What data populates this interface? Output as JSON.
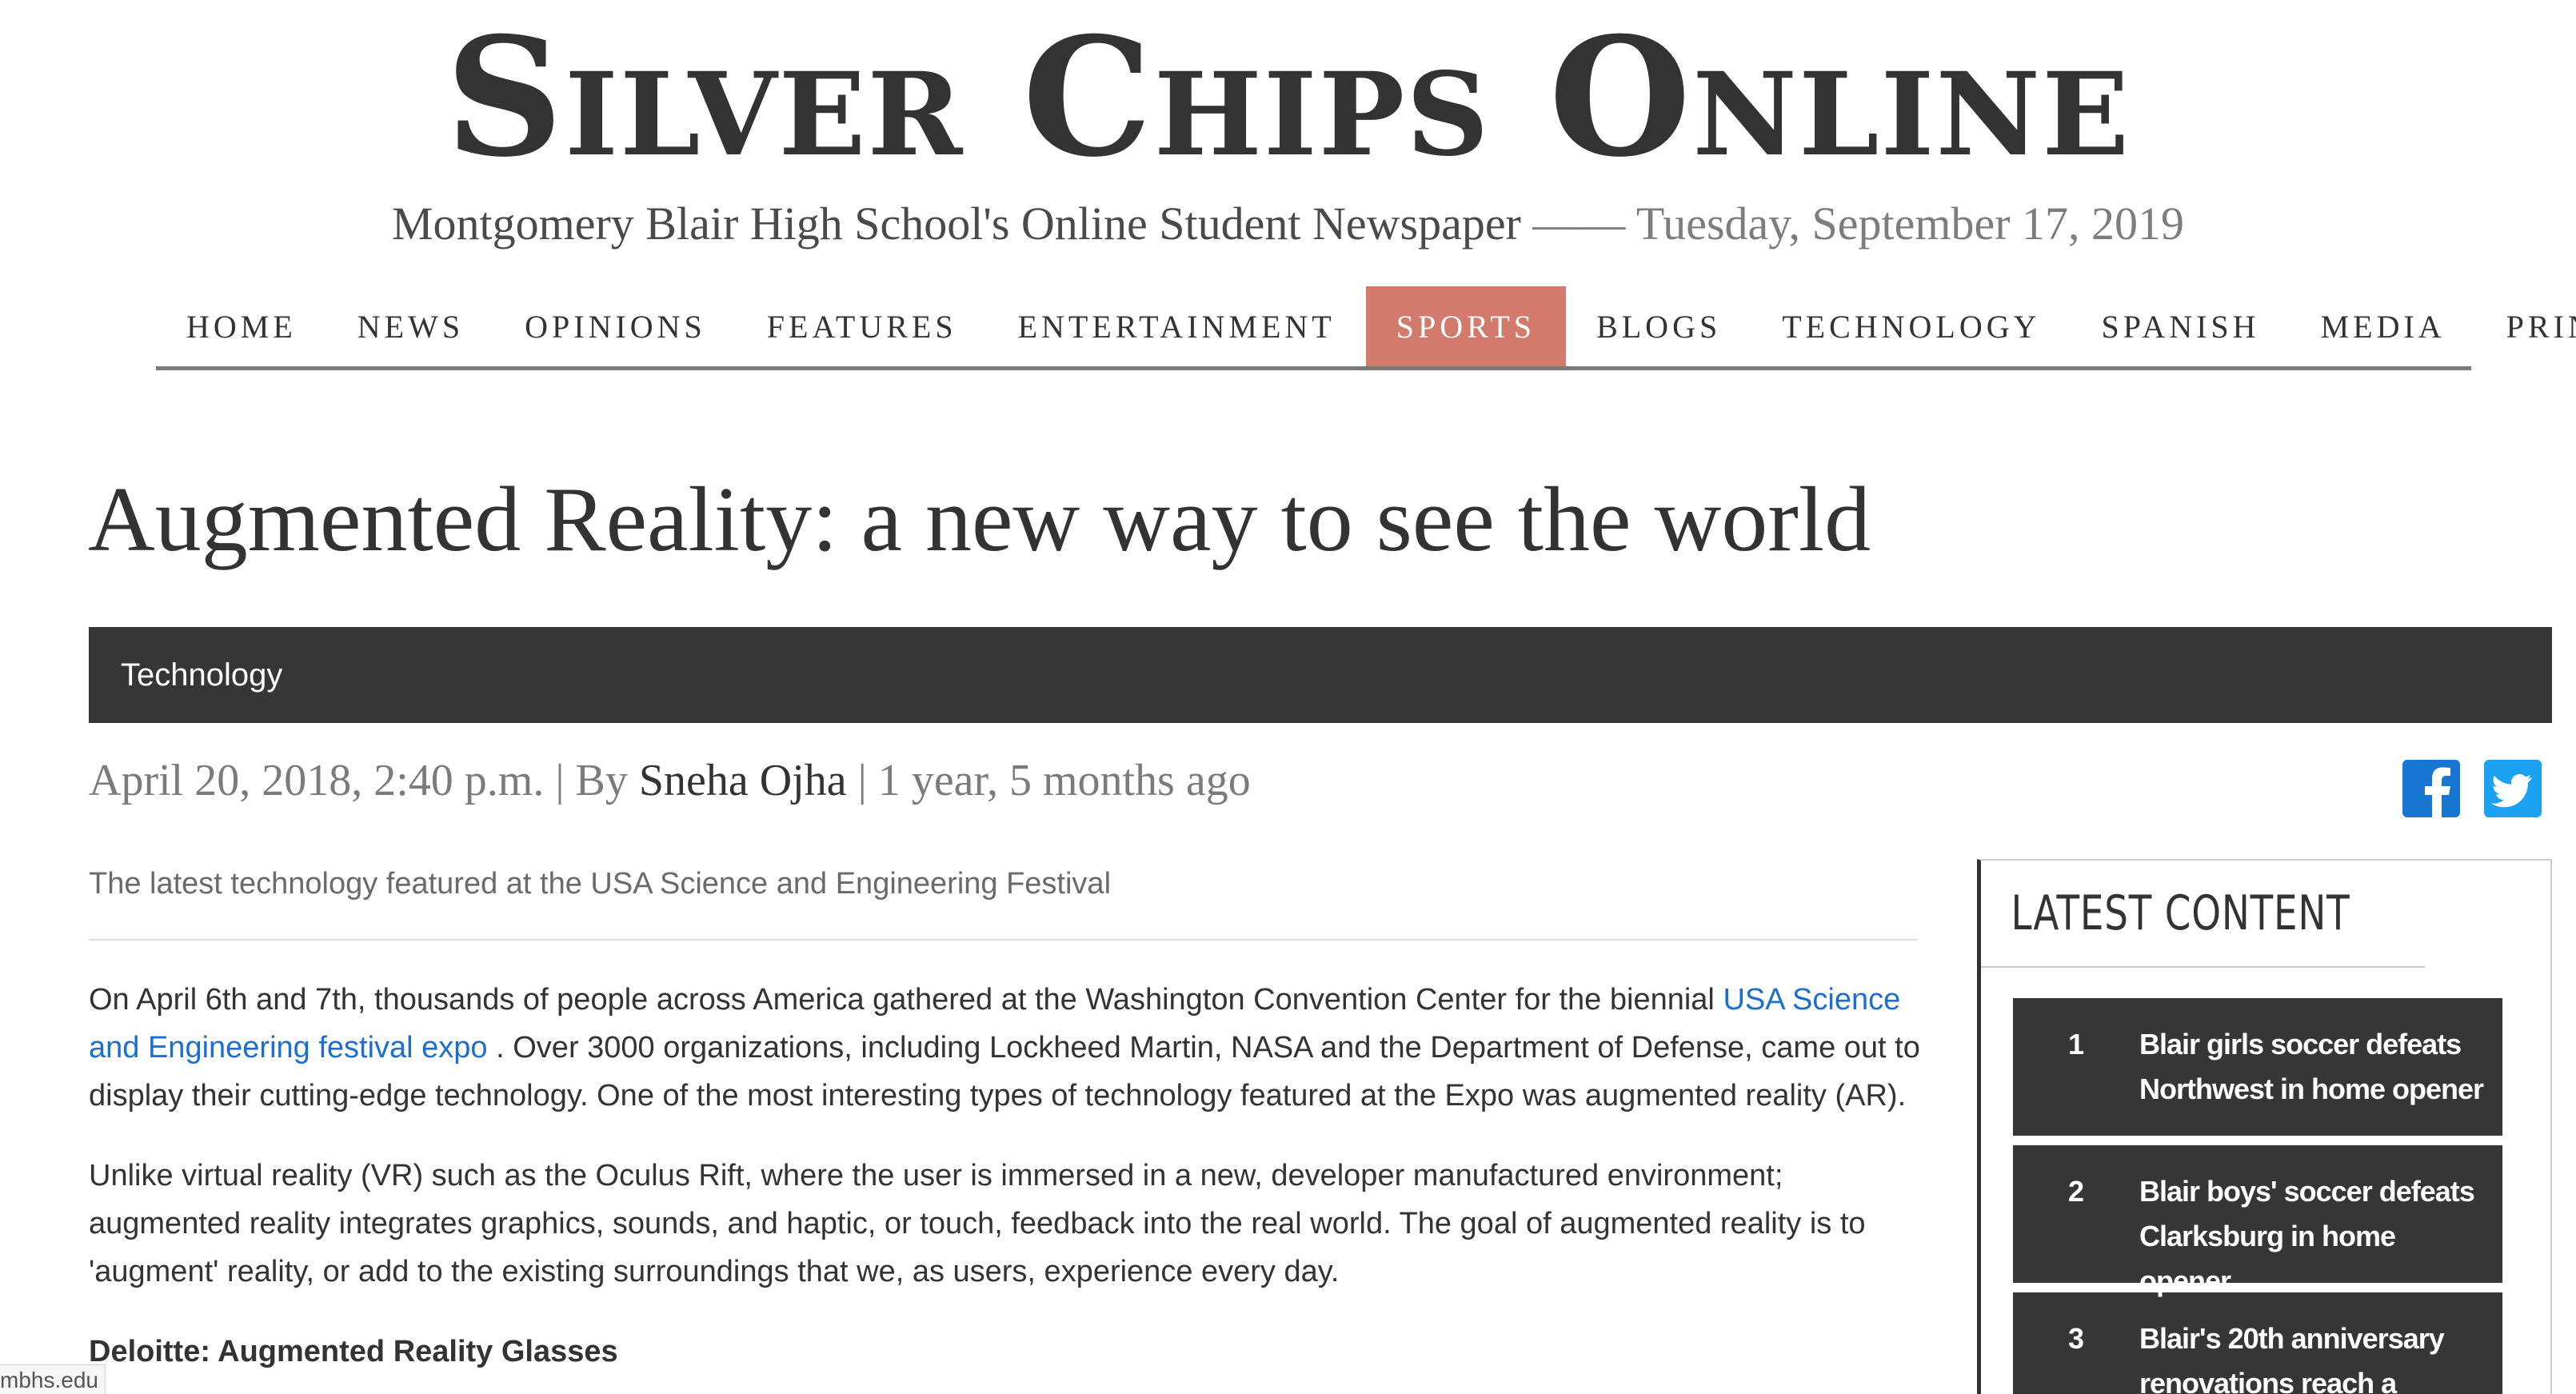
{
  "site": {
    "title": "Silver Chips Online",
    "tagline": "Montgomery Blair High School's Online Student Newspaper",
    "separator": "——",
    "date": "Tuesday, September 17, 2019"
  },
  "nav": {
    "items": [
      {
        "label": "HOME"
      },
      {
        "label": "NEWS"
      },
      {
        "label": "OPINIONS"
      },
      {
        "label": "FEATURES"
      },
      {
        "label": "ENTERTAINMENT"
      },
      {
        "label": "SPORTS"
      },
      {
        "label": "BLOGS"
      },
      {
        "label": "TECHNOLOGY"
      },
      {
        "label": "SPANISH"
      },
      {
        "label": "MEDIA"
      },
      {
        "label": "PRINT"
      }
    ],
    "active": "SPORTS"
  },
  "article": {
    "headline": "Augmented Reality: a new way to see the world",
    "category": "Technology",
    "byline": {
      "date": "April 20, 2018, 2:40 p.m.",
      "by_prefix": "| By",
      "author": "Sneha Ojha",
      "relative": "| 1 year, 5 months ago"
    },
    "subtitle": "The latest technology featured at the USA Science and Engineering Festival",
    "paragraph1": {
      "before_link": "On April 6th and 7th, thousands of people across America gathered at the Washington Convention Center for the biennial ",
      "link": "USA Science and Engineering festival expo",
      "after_link": " . Over 3000 organizations, including Lockheed Martin, NASA and the Department of Defense, came out to display their cutting-edge technology. One of the most interesting types of technology featured at the Expo was augmented reality (AR)."
    },
    "paragraph2": "Unlike virtual reality (VR) such as the Oculus Rift, where the user is immersed in a new, developer manufactured environment; augmented reality integrates graphics, sounds, and haptic, or touch, feedback into the real world. The goal of augmented reality is to 'augment' reality, or add to the existing surroundings that we, as users, experience every day.",
    "image_caption": "Deloitte: Augmented Reality Glasses"
  },
  "share": {
    "facebook_icon": "facebook-icon",
    "twitter_icon": "twitter-icon",
    "facebook_color": "#1877d2",
    "twitter_color": "#1da1f2"
  },
  "sidebar": {
    "heading": "LATEST CONTENT",
    "items": [
      {
        "num": "1",
        "title": "Blair girls soccer defeats Northwest in home opener"
      },
      {
        "num": "2",
        "title": "Blair boys' soccer defeats Clarksburg in home opener"
      },
      {
        "num": "3",
        "title": "Blair's 20th anniversary renovations reach a"
      }
    ]
  },
  "status": {
    "url": "mbhs.edu"
  },
  "colors": {
    "accent": "#d47a6c",
    "dark_bar": "#363636",
    "link": "#1a6fd0"
  }
}
